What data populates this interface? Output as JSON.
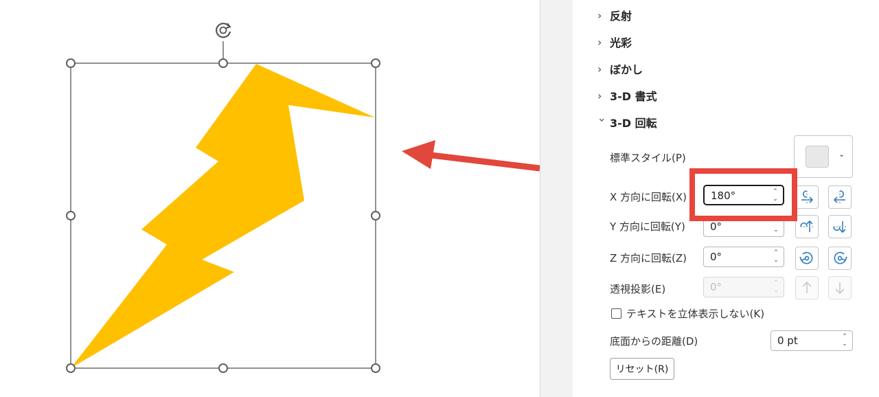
{
  "colors": {
    "bolt": "#FFC000",
    "arrow": "#E2473B",
    "highlight": "#E8453C",
    "handle_stroke": "#606060"
  },
  "canvas": {
    "shape": "lightning-bolt",
    "rotate_handle_icon": "rotate-icon"
  },
  "panel": {
    "sections": [
      {
        "label": "反射",
        "expanded": false
      },
      {
        "label": "光彩",
        "expanded": false
      },
      {
        "label": "ぼかし",
        "expanded": false
      },
      {
        "label": "3-D 書式",
        "expanded": false
      },
      {
        "label": "3-D 回転",
        "expanded": true
      }
    ],
    "preset_label": "標準スタイル(P)",
    "x_label": "X 方向に回転(X)",
    "x_value": "180°",
    "y_label": "Y 方向に回転(Y)",
    "y_value": "0°",
    "z_label": "Z 方向に回転(Z)",
    "z_value": "0°",
    "perspective_label": "透視投影(E)",
    "perspective_value": "0°",
    "keep_text_flat_label": "テキストを立体表示しない(K)",
    "distance_label": "底面からの距離(D)",
    "distance_value": "0 pt",
    "reset_label": "リセット(R)"
  }
}
